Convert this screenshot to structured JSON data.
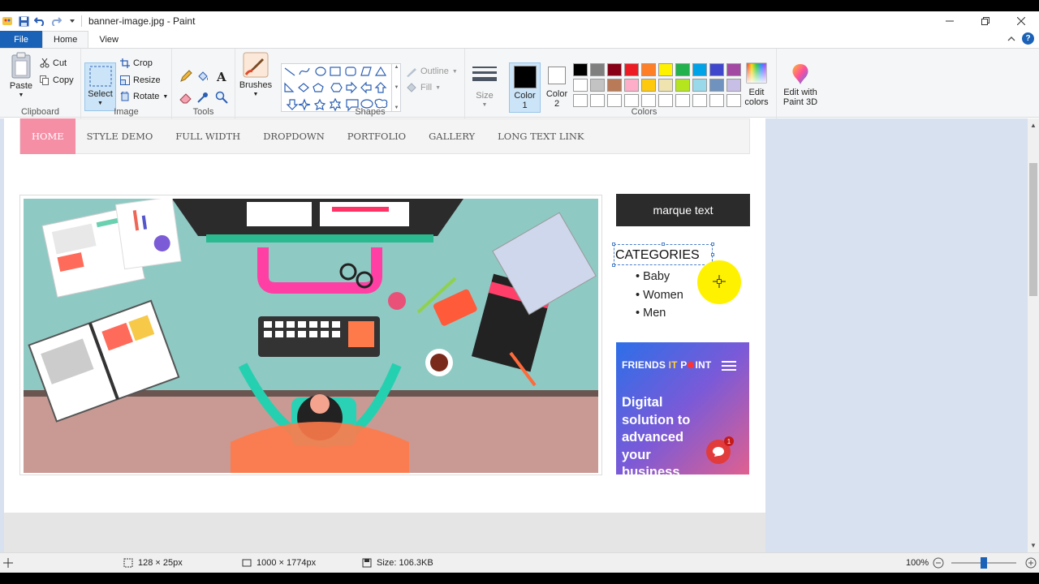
{
  "window": {
    "title": "banner-image.jpg - Paint",
    "controls": [
      "minimize",
      "restore",
      "close"
    ]
  },
  "tabs": {
    "file": "File",
    "home": "Home",
    "view": "View"
  },
  "ribbon": {
    "clipboard": {
      "label": "Clipboard",
      "paste": "Paste",
      "cut": "Cut",
      "copy": "Copy"
    },
    "image": {
      "label": "Image",
      "select": "Select",
      "crop": "Crop",
      "resize": "Resize",
      "rotate": "Rotate"
    },
    "tools": {
      "label": "Tools"
    },
    "brushes": {
      "label": "Brushes"
    },
    "shapes": {
      "label": "Shapes",
      "outline": "Outline",
      "fill": "Fill"
    },
    "size": {
      "label": "Size"
    },
    "colors": {
      "label": "Colors",
      "color1_line1": "Color",
      "color1_line2": "1",
      "color2_line1": "Color",
      "color2_line2": "2",
      "edit_line1": "Edit",
      "edit_line2": "colors",
      "paint3d_line1": "Edit with",
      "paint3d_line2": "Paint 3D",
      "color1": "#000000",
      "color2": "#ffffff",
      "palette": [
        "#000000",
        "#7f7f7f",
        "#880015",
        "#ed1c24",
        "#ff7f27",
        "#fff200",
        "#22b14c",
        "#00a2e8",
        "#3f48cc",
        "#a349a4",
        "#ffffff",
        "#c3c3c3",
        "#b97a57",
        "#ffaec9",
        "#ffc90e",
        "#efe4b0",
        "#b5e61d",
        "#99d9ea",
        "#7092be",
        "#c8bfe7",
        "#ffffff",
        "#ffffff",
        "#ffffff",
        "#ffffff",
        "#ffffff",
        "#ffffff",
        "#ffffff",
        "#ffffff",
        "#ffffff",
        "#ffffff"
      ]
    }
  },
  "site": {
    "nav": [
      "HOME",
      "STYLE DEMO",
      "FULL WIDTH",
      "DROPDOWN",
      "PORTFOLIO",
      "GALLERY",
      "LONG TEXT LINK"
    ],
    "marque": "marque text",
    "categories_title": "CATEGORIES",
    "categories": [
      "Baby",
      "Women",
      "Men"
    ],
    "ad": {
      "brand_a": "FRIENDS ",
      "brand_b": "IT",
      "brand_c": " P",
      "brand_d": "INT",
      "line1": "Digital",
      "line2": "solution to",
      "line3": "advanced",
      "line4": "your",
      "line5": "business",
      "chat_count": "1"
    }
  },
  "status": {
    "selection": "128 × 25px",
    "image_size": "1000 × 1774px",
    "file_size": "Size: 106.3KB",
    "zoom": "100%",
    "zoom_level": 0.5
  }
}
